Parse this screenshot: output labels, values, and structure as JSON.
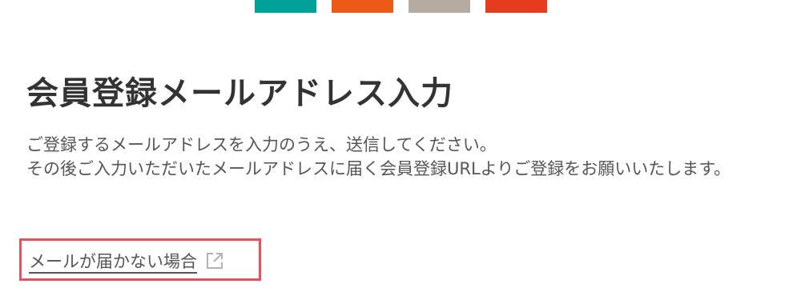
{
  "header": {
    "stripe_colors": [
      "#00a196",
      "#ec5a15",
      "#b5aba1",
      "#e63c1e"
    ]
  },
  "main": {
    "title": "会員登録メールアドレス入力",
    "description": [
      "ご登録するメールアドレスを入力のうえ、送信してください。",
      "その後ご入力いただいたメールアドレスに届く会員登録URLよりご登録をお願いいたします。"
    ],
    "help_link": {
      "label": "メールが届かない場合",
      "icon": "external-link-icon",
      "highlight_color": "#e8505b"
    }
  }
}
